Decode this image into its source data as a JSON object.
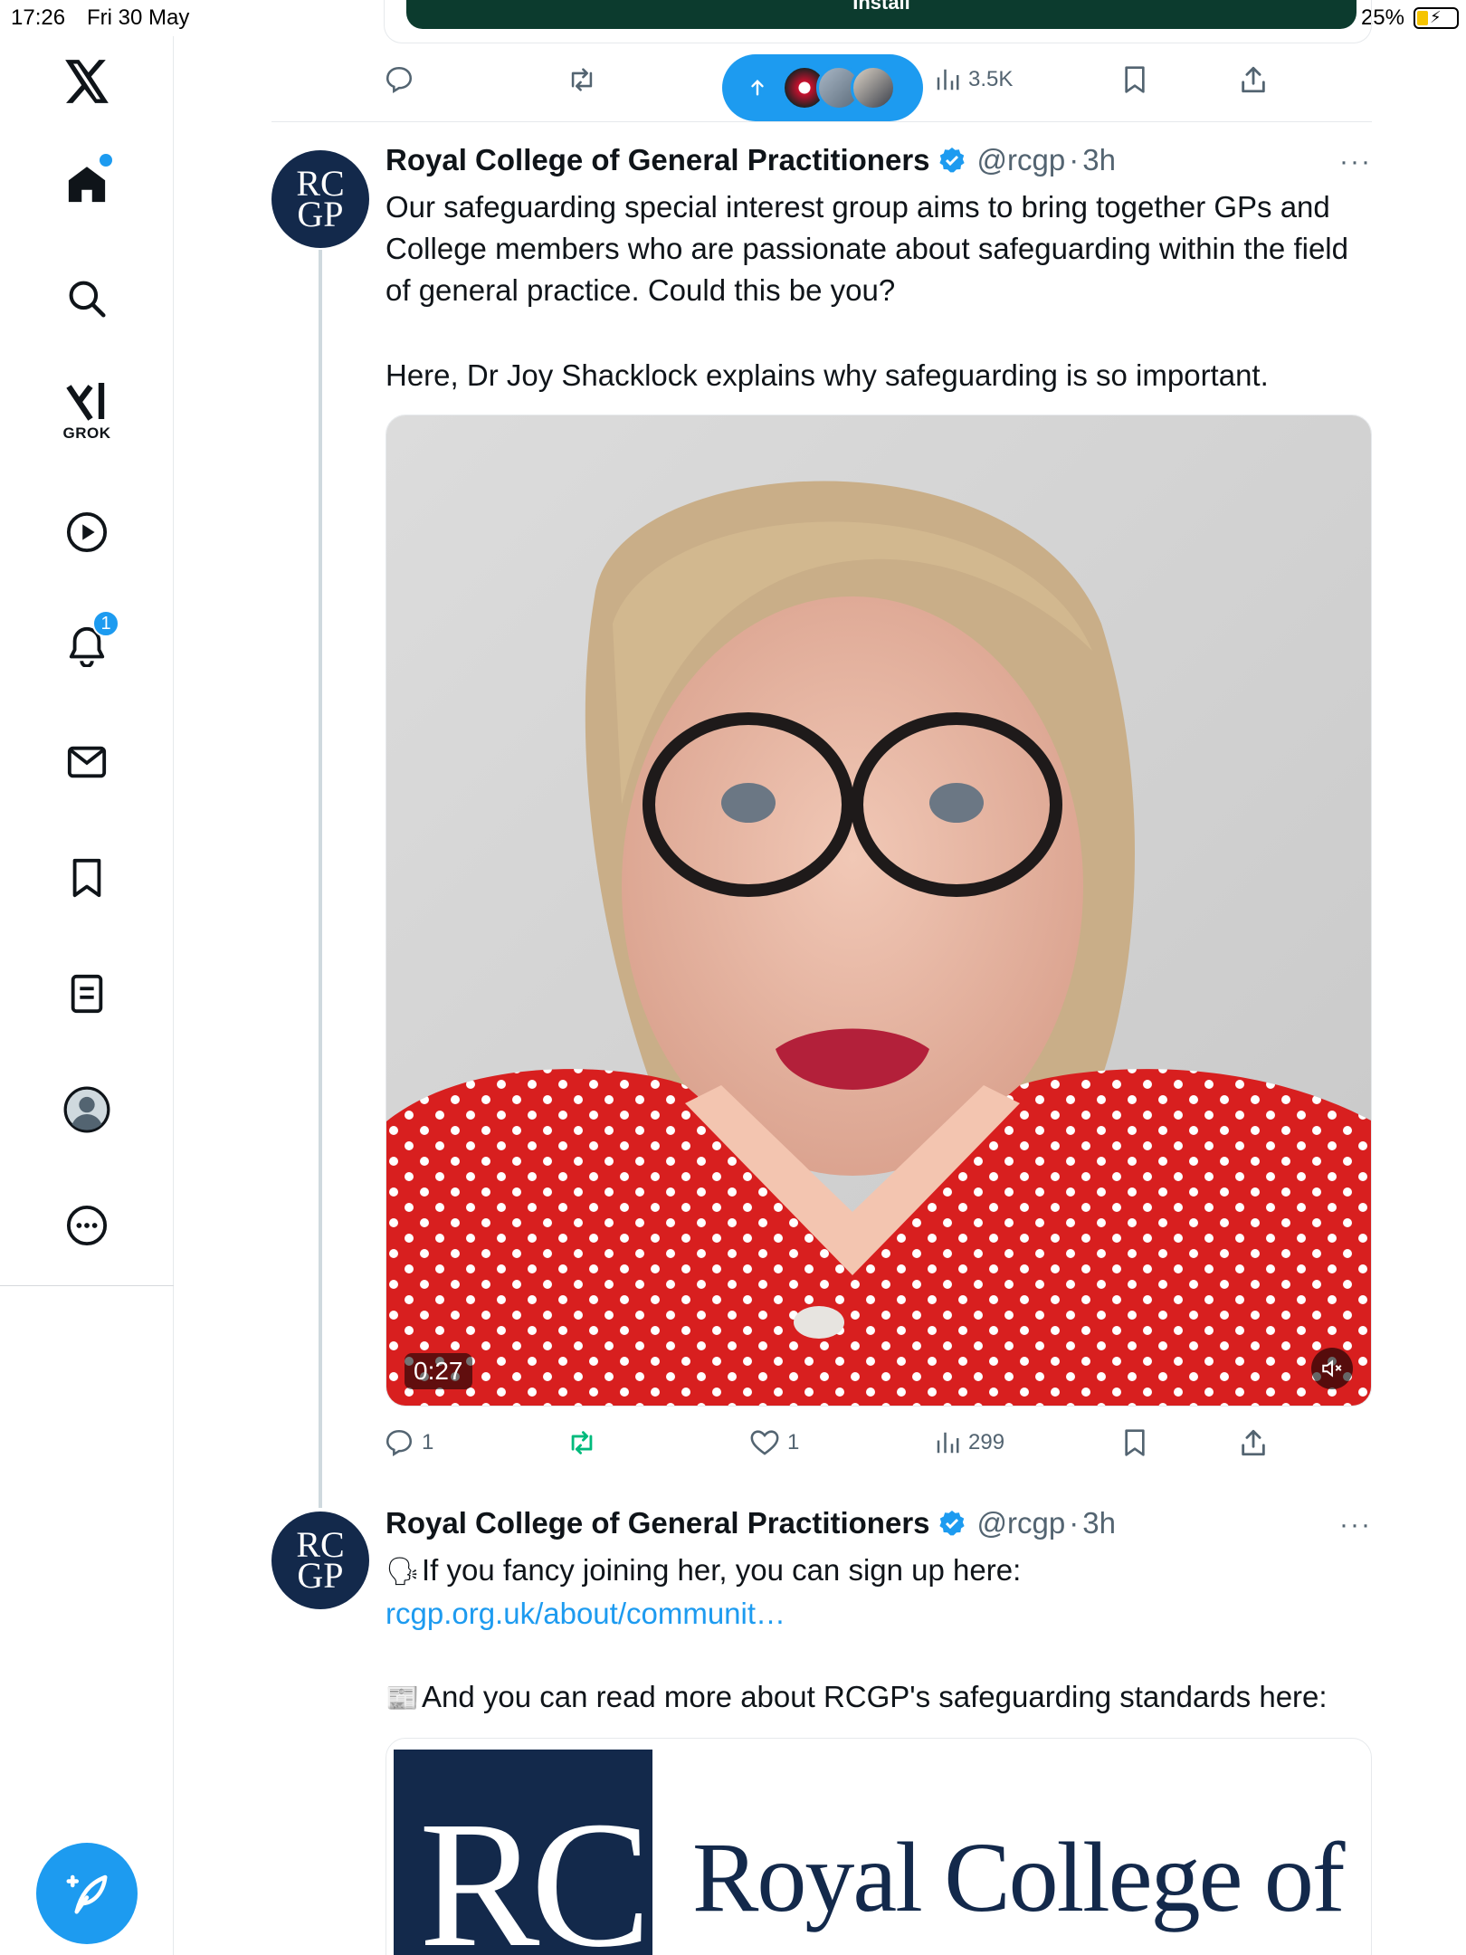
{
  "status_bar": {
    "time": "17:26",
    "date": "Fri 30 May",
    "battery": "25%"
  },
  "top": {
    "install_label": "Install"
  },
  "prev_tweet_actions": {
    "views": "3.5K"
  },
  "tweets": [
    {
      "avatar_text_1": "RC",
      "avatar_text_2": "GP",
      "name": "Royal College of General Practitioners",
      "handle": "@rcgp",
      "sep": "·",
      "time": "3h",
      "more": "···",
      "text_p1": "Our safeguarding special interest group aims to bring together GPs and College members who are passionate about safeguarding within the field of general practice. Could this be you?",
      "text_p2": "Here, Dr Joy Shacklock explains why safeguarding is so important.",
      "video_duration": "0:27",
      "replies": "1",
      "likes": "1",
      "views": "299"
    },
    {
      "avatar_text_1": "RC",
      "avatar_text_2": "GP",
      "name": "Royal College of General Practitioners",
      "handle": "@rcgp",
      "sep": "·",
      "time": "3h",
      "more": "···",
      "text_p1_prefix": "If you fancy joining her, you can sign up here: ",
      "text_p1_link": "rcgp.org.uk/about/communit…",
      "text_p2": "And you can read more about RCGP's safeguarding standards here:",
      "card_logo": "RC",
      "card_title": "Royal College of"
    }
  ],
  "sidebar": {
    "grok_label": "GROK",
    "notifications_count": "1"
  },
  "colors": {
    "accent": "#1d9bf0",
    "rcgp_navy": "#13294b",
    "retweet_green": "#00ba7c"
  }
}
